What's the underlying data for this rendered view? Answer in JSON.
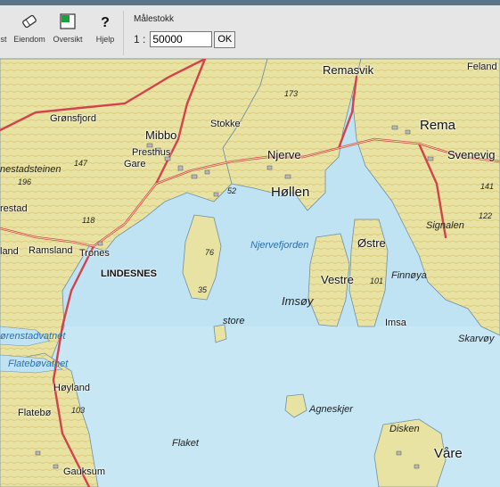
{
  "toolbar": {
    "tools": [
      {
        "label": "st",
        "icon": "partial-tool-icon"
      },
      {
        "label": "Eiendom",
        "icon": "eraser-icon"
      },
      {
        "label": "Oversikt",
        "icon": "overview-map-icon"
      },
      {
        "label": "Hjelp",
        "icon": "help-question-icon"
      }
    ],
    "scale": {
      "title": "Målestokk",
      "prefix": "1 :",
      "value": "50000",
      "ok_label": "OK"
    }
  },
  "map": {
    "labels": {
      "remasvik": "Remasvik",
      "feland": "Feland",
      "rema": "Rema",
      "gronsfjord": "Grønsfjord",
      "stokke": "Stokke",
      "mibo": "Mibbo",
      "presthus": "Presthus",
      "gare": "Gare",
      "njerve": "Njerve",
      "hollen": "Høllen",
      "svenevig": "Svenevig",
      "nestadsteinen": "nestadsteinen",
      "restad": "restad",
      "njervefjorden": "Njervefjorden",
      "ostre": "Østre",
      "signalen": "Signalen",
      "land": "land",
      "ramsland": "Ramsland",
      "trones": "Trones",
      "lindesnes": "LINDESNES",
      "finnoya": "Finnøya",
      "vestre": "Vestre",
      "imsoy": "Imsøy",
      "store": "store",
      "imsa": "Imsa",
      "skarvoy": "Skarvøy",
      "sorenstadvatnet": "ørenstadvatnet",
      "flatebovatnet": "Flatebøvatnet",
      "hoyland": "Høyland",
      "flatebo": "Flatebø",
      "agneskjer": "Agneskjer",
      "disken": "Disken",
      "flaket": "Flaket",
      "vare": "Våre",
      "gauksum": "Gauksum"
    },
    "elevations": {
      "e173": "173",
      "e147": "147",
      "e196": "196",
      "e118": "118",
      "e52": "52",
      "e76": "76",
      "e35": "35",
      "e101": "101",
      "e141": "141",
      "e122": "122",
      "e103": "103"
    }
  }
}
